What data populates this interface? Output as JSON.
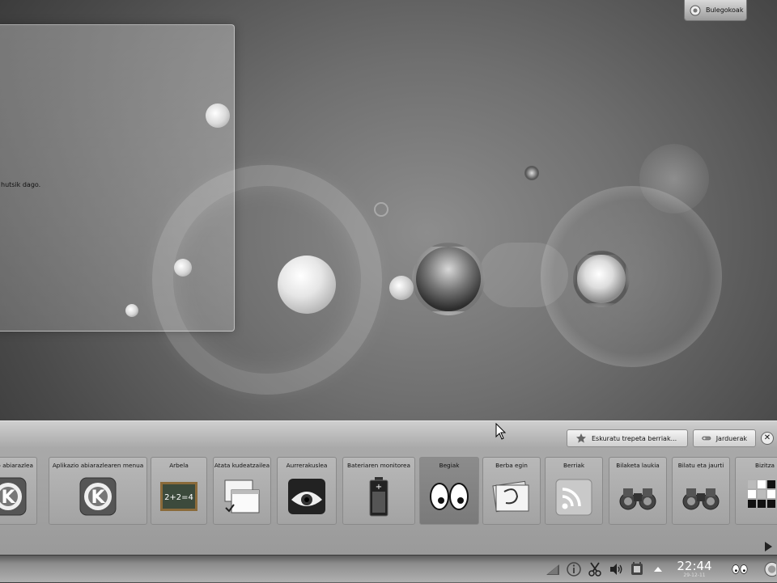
{
  "desktop": {
    "folder_view": {
      "empty_message": "hutsik dago."
    },
    "activities_label": "Bulegokoak"
  },
  "widget_explorer": {
    "get_new_widgets": "Eskuratu trepeta berriak...",
    "activities_button": "Jarduerak",
    "close_icon": "close-icon",
    "widgets": [
      {
        "name": "...asio abiarazlea",
        "icon": "kde-logo-icon",
        "selected": false
      },
      {
        "name": "Aplikazio abiarazlearen menua",
        "icon": "kde-logo-icon",
        "selected": false
      },
      {
        "name": "Arbela",
        "icon": "chalkboard-icon",
        "selected": false
      },
      {
        "name": "Atata kudeatzailea",
        "icon": "windows-icon",
        "selected": false
      },
      {
        "name": "Aurrerakuslea",
        "icon": "eye-icon",
        "selected": false
      },
      {
        "name": "Bateriaren monitorea",
        "icon": "battery-icon",
        "selected": false
      },
      {
        "name": "Begiak",
        "icon": "eyes-icon",
        "selected": true
      },
      {
        "name": "Berba egin",
        "icon": "talk-icon",
        "selected": false
      },
      {
        "name": "Berriak",
        "icon": "rss-icon",
        "selected": false
      },
      {
        "name": "Bilaketa laukia",
        "icon": "binoculars-icon",
        "selected": false
      },
      {
        "name": "Bilatu eta jaurti",
        "icon": "binoculars-icon",
        "selected": false
      },
      {
        "name": "Bizitza",
        "icon": "grid-icon",
        "selected": false
      }
    ]
  },
  "panel": {
    "clock_time": "22:44",
    "clock_date": "29-12-11",
    "tray_icons": [
      "network-icon",
      "info-icon",
      "scissors-icon",
      "speaker-icon",
      "device-icon",
      "arrow-up-icon"
    ]
  },
  "colors": {
    "selected_widget": "#7a7a7a",
    "panel": "#8c8c8c"
  }
}
